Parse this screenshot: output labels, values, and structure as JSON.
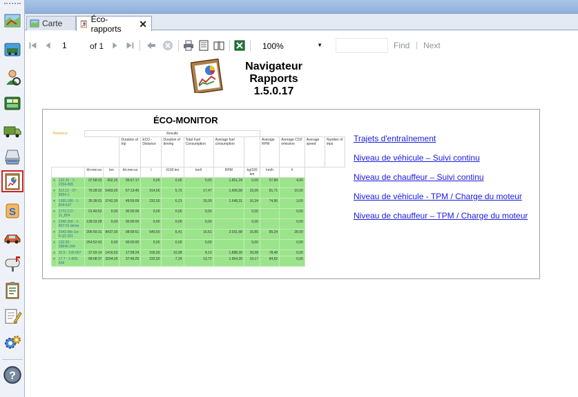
{
  "tabs": [
    {
      "label": "Carte",
      "icon": "map-icon",
      "active": false
    },
    {
      "label": "Éco-rapports",
      "icon": "report-icon",
      "active": true
    }
  ],
  "sidebar": {
    "icons": [
      "map-icon",
      "vehicle-card-icon",
      "driver-icon",
      "dashboard-icon",
      "truck-icon",
      "scanner-icon",
      "eco-report-icon",
      "s-document-icon",
      "car-icon",
      "mailbox-icon",
      "clipboard-icon",
      "notes-icon",
      "settings-gears-icon",
      "help-icon"
    ],
    "active_index": 6
  },
  "toolbar": {
    "page_value": "1",
    "of_label": "of",
    "page_total": "1",
    "zoom_value": "100%",
    "find_label": "Find",
    "find_separator": "|",
    "next_label": "Next"
  },
  "report": {
    "title_line1": "Navigateur",
    "title_line2": "Rapports",
    "version": "1.5.0.17",
    "eco_title": "ÉCO-MONITOR",
    "preview": {
      "presence_label": "Presence",
      "results_label": "Results",
      "columns": [
        "Duration of trip",
        "ECO - Distance",
        "Duration of driving",
        "Total Fuel Consumption",
        "Average fuel consumption",
        "",
        "Average RPM",
        "Average CO2 emission",
        "Average speed",
        "Number of trips"
      ],
      "units": [
        "hh:mm:ss",
        "km",
        "hh:mm:ss",
        "l",
        "l/100 km",
        "km/l",
        "RPM",
        "kg/100 km",
        "km/h",
        "#"
      ],
      "rows": [
        [
          "132.10 - 1-2354-895",
          "07:58:23",
          "402,26",
          "06:57:17",
          "0,00",
          "0,00",
          "0,00",
          "1.851,24",
          "0,00",
          "57,84",
          "4,00"
        ],
        [
          "113.12 - 37-8654-1",
          "76:28:32",
          "5493,00",
          "67:13:45",
          "314,50",
          "5,73",
          "17,47",
          "1.906,58",
          "15,06",
          "81,71",
          "10,00"
        ],
        [
          "1365.180 - 1-804-637",
          "35:38:01",
          "3742,00",
          "49:59:09",
          "232,50",
          "6,21",
          "16,09",
          "1.648,31",
          "16,34",
          "74,96",
          "3,00"
        ],
        [
          "1772.172 - 11_804",
          "01:49:52",
          "0,00",
          "00:00:00",
          "0,00",
          "0,00",
          "0,00",
          "",
          "0,00",
          "",
          "0,00"
        ],
        [
          "2340.356 - 1-807-01 demo",
          "128:33:28",
          "0,00",
          "00:00:00",
          "0,00",
          "0,00",
          "0,00",
          "",
          "0,00",
          "",
          "0,00"
        ],
        [
          "2043.98x Ge - 6-Q2-201",
          "206:59:31",
          "8437,00",
          "98:58:51",
          "540,50",
          "6,41",
          "15,61",
          "2.031,68",
          "16,85",
          "85,24",
          "28,00"
        ],
        [
          "132.30 - 28645-104",
          "264:52:43",
          "0,00",
          "00:00:00",
          "0,00",
          "0,00",
          "0,00",
          "",
          "0,00",
          "",
          "0,00"
        ],
        [
          "32.5 - 135-657",
          "37:03:14",
          "1416,50",
          "17:58:24",
          "155,00",
          "10,98",
          "9,10",
          "1.888,39",
          "28,98",
          "78,48",
          "6,00"
        ],
        [
          "17.7 - 1-808-659",
          "68:08:27",
          "3204,00",
          "37:46:25",
          "232,50",
          "7,29",
          "13,72",
          "1.964,28",
          "19,17",
          "84,82",
          "0,00"
        ]
      ]
    },
    "links": [
      "Trajets d'entraînement",
      "Niveau de véhicule – Suivi continu",
      "Niveau de chauffeur – Suivi continu",
      "Niveau de véhicule - TPM / Charge du moteur",
      "Niveau de chauffeur – TPM / Charge du moteur"
    ]
  }
}
